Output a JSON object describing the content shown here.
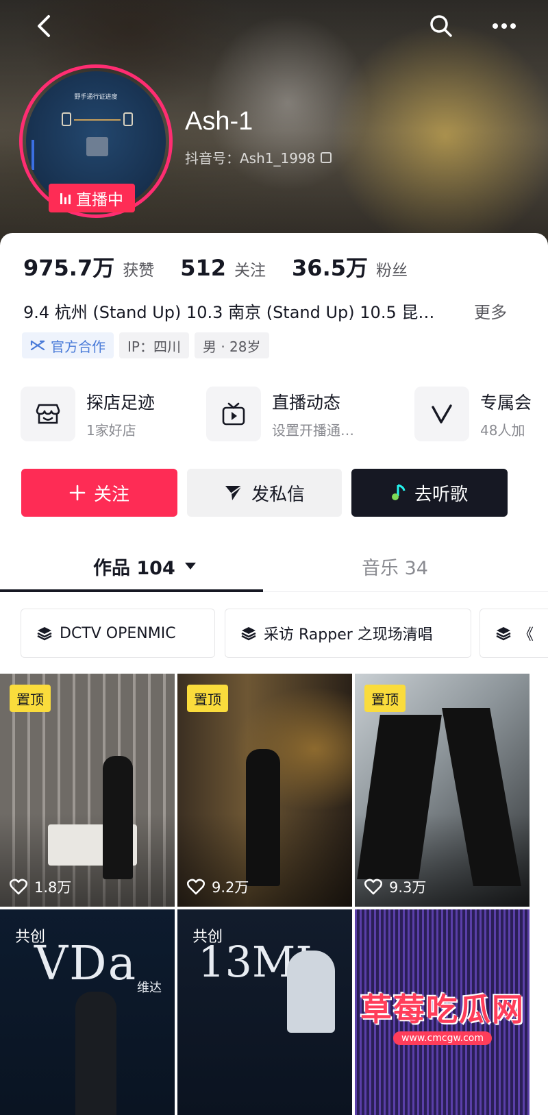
{
  "header": {
    "nickname": "Ash-1",
    "douyin_id": "抖音号：Ash1_1998",
    "live_badge": "直播中",
    "avatar_caption": "野手通行证进度"
  },
  "stats": [
    {
      "value": "975.7万",
      "label": "获赞"
    },
    {
      "value": "512",
      "label": "关注"
    },
    {
      "value": "36.5万",
      "label": "粉丝"
    }
  ],
  "bio": {
    "text": "9.4 杭州 (Stand Up) 10.3 南京 (Stand Up) 10.5 昆…",
    "more": "更多"
  },
  "tags": {
    "official": "官方合作",
    "ip": "IP：四川",
    "gender_age": "男 · 28岁"
  },
  "services": [
    {
      "title": "探店足迹",
      "subtitle": "1家好店",
      "icon": "shop-icon"
    },
    {
      "title": "直播动态",
      "subtitle": "设置开播通…",
      "icon": "tv-icon"
    },
    {
      "title": "专属会",
      "subtitle": "48人加",
      "icon": "v-icon"
    }
  ],
  "actions": {
    "follow": "关注",
    "message": "发私信",
    "music": "去听歌"
  },
  "tabs": {
    "works": "作品 104",
    "music": "音乐 34"
  },
  "collections": [
    {
      "label": "DCTV OPENMIC"
    },
    {
      "label": "采访 Rapper 之现场清唱"
    },
    {
      "label": "《"
    }
  ],
  "grid": [
    {
      "badge": "置顶",
      "likes": "1.8万"
    },
    {
      "badge": "置顶",
      "likes": "9.2万"
    },
    {
      "badge": "置顶",
      "likes": "9.3万"
    },
    {
      "badge": "共创",
      "overlay_text": "VDa",
      "overlay_sub": "维达"
    },
    {
      "badge": "共创",
      "overlay_text": "13MI"
    },
    {}
  ],
  "watermark": {
    "title": "草莓吃瓜网",
    "url": "www.cmcgw.com"
  },
  "colors": {
    "brand_red": "#fe2c55",
    "dark": "#161823",
    "pin_yellow": "#fadc3c"
  }
}
